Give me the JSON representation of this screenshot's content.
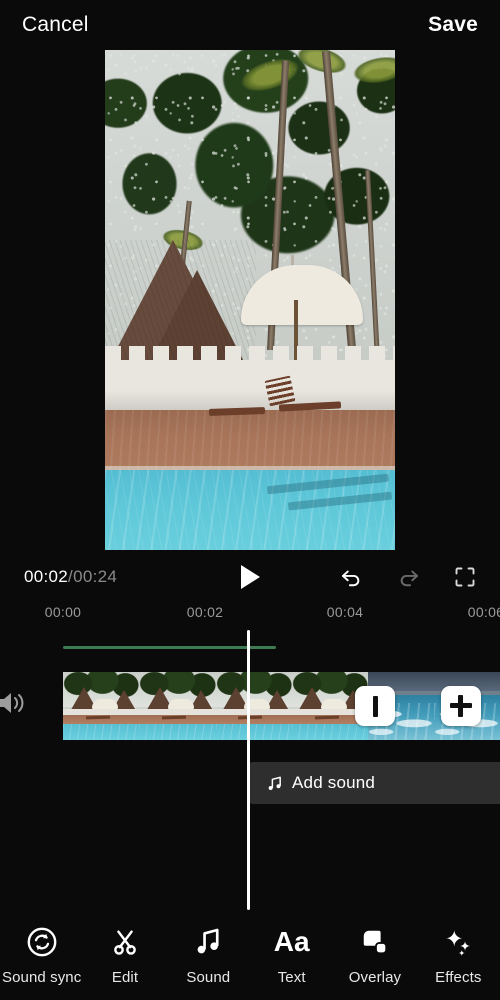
{
  "header": {
    "cancel_label": "Cancel",
    "save_label": "Save"
  },
  "preview": {
    "description": "Tropical resort video frame: palm trees, thatched hut, white umbrella, loungers and turquoise swimming pool"
  },
  "player": {
    "current_time": "00:02",
    "separator": "/",
    "total_time": "00:24",
    "play_icon": "play-icon",
    "undo_icon": "undo-icon",
    "redo_icon": "redo-icon",
    "expand_icon": "expand-icon"
  },
  "timeline": {
    "ruler_ticks": [
      "00:00",
      "00:02",
      "00:04",
      "00:06"
    ],
    "volume_icon": "speaker-icon",
    "transition_button_icon": "transition-bar-icon",
    "add_clip_button_icon": "plus-icon",
    "add_sound": {
      "label": "Add sound",
      "icon": "music-note-icon"
    },
    "playhead_position": "00:02"
  },
  "toolbar": {
    "items": [
      {
        "label": "Sound sync",
        "icon": "sound-sync-icon"
      },
      {
        "label": "Edit",
        "icon": "scissors-icon"
      },
      {
        "label": "Sound",
        "icon": "music-note-icon"
      },
      {
        "label": "Text",
        "icon": "text-aa-icon"
      },
      {
        "label": "Overlay",
        "icon": "overlay-squares-icon"
      },
      {
        "label": "Effects",
        "icon": "sparkle-icon"
      }
    ]
  },
  "colors": {
    "background": "#0a0a0a",
    "accent_green": "#3e7a52",
    "playhead": "#ffffff",
    "add_sound_bar": "#2e2e2e",
    "pool_water": "#5cc6d8"
  }
}
